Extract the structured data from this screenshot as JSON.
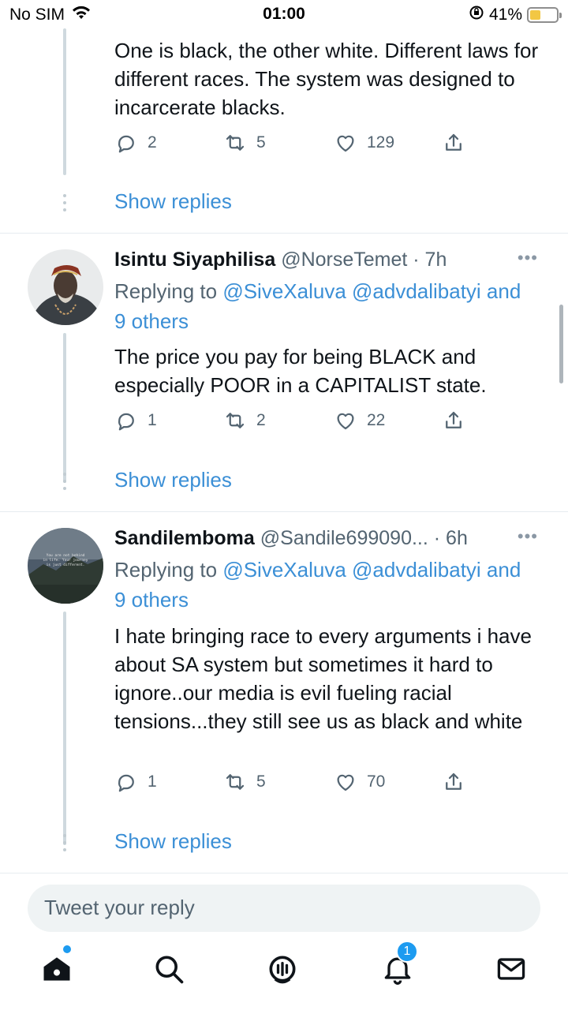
{
  "status_bar": {
    "carrier": "No SIM",
    "time": "01:00",
    "battery_percent": "41%",
    "battery_level": 0.41,
    "icons": [
      "wifi-icon",
      "rotation-lock-icon",
      "battery-icon"
    ]
  },
  "tweets": [
    {
      "text": "One is black, the other white. Different laws for different races. The system was designed to incarcerate blacks.",
      "replies": "2",
      "retweets": "5",
      "likes": "129",
      "show_replies": "Show replies"
    },
    {
      "name": "Isintu Siyaphilisa",
      "handle": "@NorseTemet · 7h",
      "replying_prefix": "Replying to",
      "replying_users": "@SiveXaluva @advdalibatyi and",
      "replying_others": "9 others",
      "text": "The price you pay for being BLACK and especially POOR in a CAPITALIST state.",
      "replies": "1",
      "retweets": "2",
      "likes": "22",
      "show_replies": "Show replies",
      "more": "•••"
    },
    {
      "name": "Sandilemboma",
      "handle": "@Sandile699090... · 6h",
      "replying_prefix": "Replying to",
      "replying_users": "@SiveXaluva @advdalibatyi and",
      "replying_others": "9 others",
      "text": "I hate bringing race to every arguments i have about SA system but sometimes it hard to ignore..our media is evil fueling racial tensions...they still see us as black and white",
      "replies": "1",
      "retweets": "5",
      "likes": "70",
      "show_replies": "Show replies",
      "more": "•••",
      "avatar_text": "You are not behind in life. Your journey is just different."
    }
  ],
  "reply_box": {
    "placeholder": "Tweet your reply"
  },
  "tab_bar": {
    "items": [
      "home-icon",
      "search-icon",
      "spaces-icon",
      "notifications-icon",
      "messages-icon"
    ],
    "notification_count": "1"
  },
  "colors": {
    "accent": "#1d9bf0",
    "link": "#3b8fd6",
    "muted": "#536471"
  }
}
